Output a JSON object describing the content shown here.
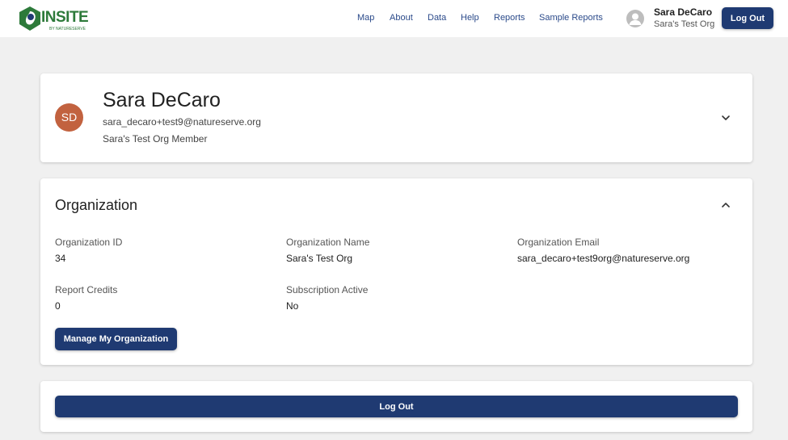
{
  "header": {
    "logo_text": "INSITE",
    "logo_sub": "BY NATURESERVE",
    "nav": [
      {
        "label": "Map"
      },
      {
        "label": "About"
      },
      {
        "label": "Data"
      },
      {
        "label": "Help"
      },
      {
        "label": "Reports"
      },
      {
        "label": "Sample Reports"
      }
    ],
    "user_name": "Sara DeCaro",
    "user_org": "Sara's Test Org",
    "logout_label": "Log Out"
  },
  "profile": {
    "initials": "SD",
    "name": "Sara DeCaro",
    "email": "sara_decaro+test9@natureserve.org",
    "role": "Sara's Test Org Member",
    "toggle_icon": "chevron-down-icon"
  },
  "organization": {
    "title": "Organization",
    "toggle_icon": "chevron-up-icon",
    "fields": {
      "id_label": "Organization ID",
      "id_value": "34",
      "name_label": "Organization Name",
      "name_value": "Sara's Test Org",
      "email_label": "Organization Email",
      "email_value": "sara_decaro+test9org@natureserve.org",
      "credits_label": "Report Credits",
      "credits_value": "0",
      "subscription_label": "Subscription Active",
      "subscription_value": "No"
    },
    "manage_label": "Manage My Organization"
  },
  "footer_card": {
    "logout_label": "Log Out"
  },
  "colors": {
    "primary": "#1f3a72",
    "nav_link": "#2b4a8a",
    "avatar": "#c2623f",
    "logo_green": "#2d7a3a",
    "background": "#f0f0f0"
  }
}
